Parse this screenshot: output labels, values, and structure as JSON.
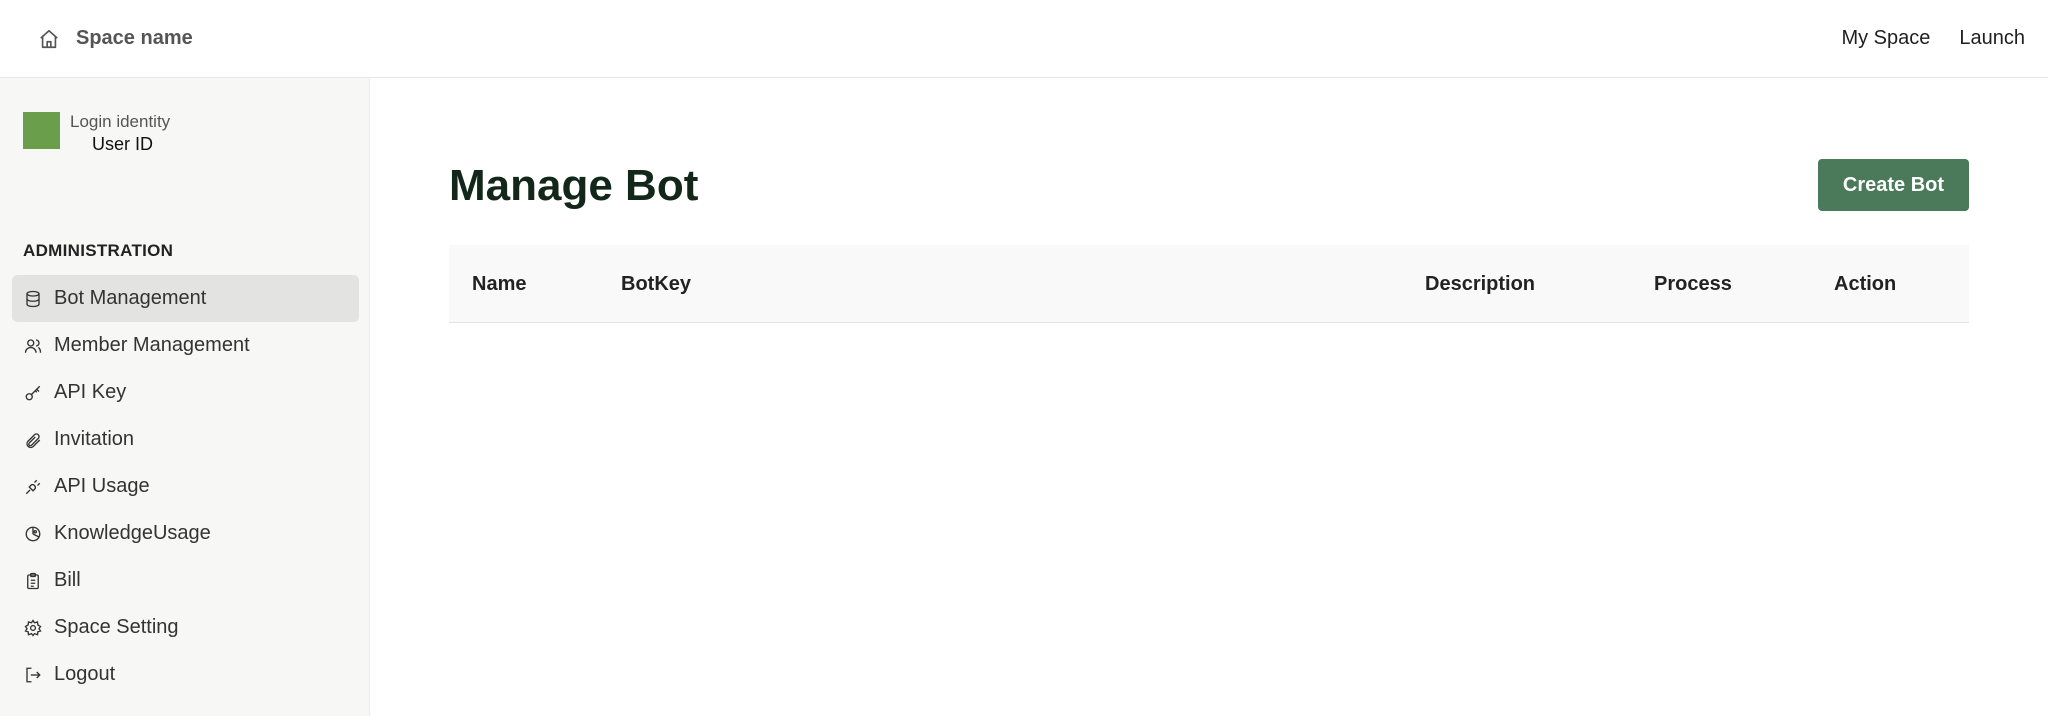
{
  "header": {
    "space_name": "Space name",
    "nav": [
      "My Space",
      "Launch"
    ]
  },
  "sidebar": {
    "login_identity": "Login identity",
    "user_id": "User ID",
    "section_title": "ADMINISTRATION",
    "items": [
      {
        "label": "Bot Management",
        "icon": "database-icon",
        "active": true
      },
      {
        "label": "Member Management",
        "icon": "users-icon"
      },
      {
        "label": "API Key",
        "icon": "key-icon"
      },
      {
        "label": "Invitation",
        "icon": "paperclip-icon"
      },
      {
        "label": "API Usage",
        "icon": "plug-icon"
      },
      {
        "label": "KnowledgeUsage",
        "icon": "chart-pie-icon"
      },
      {
        "label": "Bill",
        "icon": "clipboard-icon"
      },
      {
        "label": "Space Setting",
        "icon": "gear-icon"
      },
      {
        "label": "Logout",
        "icon": "logout-icon"
      }
    ]
  },
  "main": {
    "title": "Manage Bot",
    "create_button": "Create Bot",
    "columns": [
      "Name",
      "BotKey",
      "Description",
      "Process",
      "Action"
    ]
  },
  "colors": {
    "accent": "#4a7a5a",
    "avatar": "#6a9e4a",
    "sidebar_bg": "#f7f7f6",
    "active_item_bg": "#e3e3e1"
  }
}
